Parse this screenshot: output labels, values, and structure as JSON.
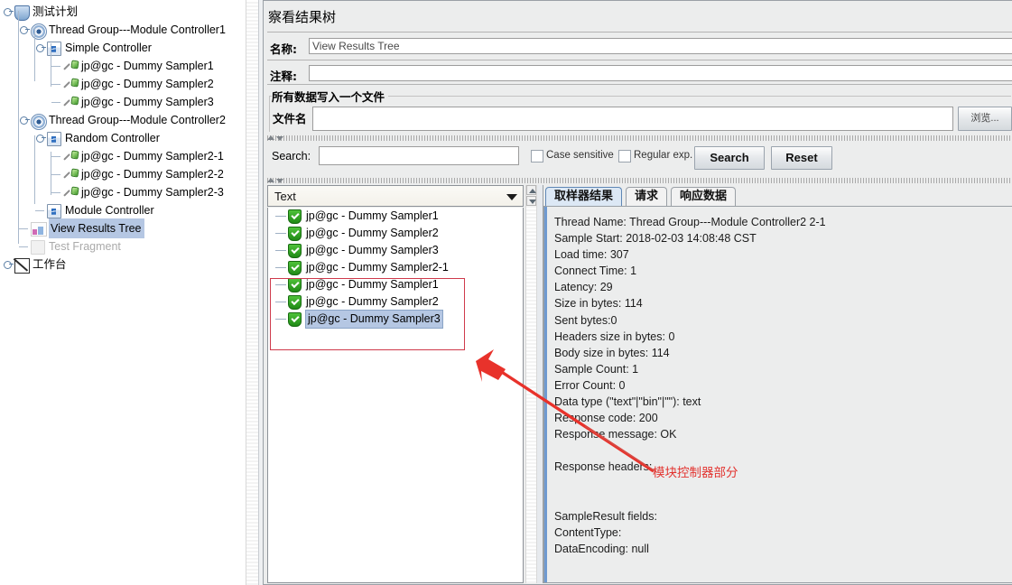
{
  "tree": {
    "nodes": [
      {
        "label": "测试计划",
        "icon": "test-plan-icon",
        "depth": 0,
        "handle": true,
        "state": "normal"
      },
      {
        "label": "Thread Group---Module Controller1",
        "icon": "thread-group-icon",
        "depth": 1,
        "handle": true,
        "state": "normal"
      },
      {
        "label": "Simple Controller",
        "icon": "controller-icon",
        "depth": 2,
        "handle": true,
        "state": "normal"
      },
      {
        "label": "jp@gc - Dummy Sampler1",
        "icon": "sampler-icon",
        "depth": 3,
        "handle": false,
        "state": "normal"
      },
      {
        "label": "jp@gc - Dummy Sampler2",
        "icon": "sampler-icon",
        "depth": 3,
        "handle": false,
        "state": "normal"
      },
      {
        "label": "jp@gc - Dummy Sampler3",
        "icon": "sampler-icon",
        "depth": 3,
        "handle": false,
        "state": "normal"
      },
      {
        "label": "Thread Group---Module Controller2",
        "icon": "thread-group-icon",
        "depth": 1,
        "handle": true,
        "state": "normal"
      },
      {
        "label": "Random Controller",
        "icon": "controller-icon",
        "depth": 2,
        "handle": true,
        "state": "normal"
      },
      {
        "label": "jp@gc - Dummy Sampler2-1",
        "icon": "sampler-icon",
        "depth": 3,
        "handle": false,
        "state": "normal"
      },
      {
        "label": "jp@gc - Dummy Sampler2-2",
        "icon": "sampler-icon",
        "depth": 3,
        "handle": false,
        "state": "normal"
      },
      {
        "label": "jp@gc - Dummy Sampler2-3",
        "icon": "sampler-icon",
        "depth": 3,
        "handle": false,
        "state": "normal"
      },
      {
        "label": "Module Controller",
        "icon": "controller-icon",
        "depth": 2,
        "handle": false,
        "state": "normal"
      },
      {
        "label": "View Results Tree",
        "icon": "view-results-tree-icon",
        "depth": 1,
        "handle": false,
        "state": "selected"
      },
      {
        "label": "Test Fragment",
        "icon": "test-fragment-icon",
        "depth": 1,
        "handle": false,
        "state": "disabled"
      },
      {
        "label": "工作台",
        "icon": "workbench-icon",
        "depth": 0,
        "handle": true,
        "state": "normal"
      }
    ]
  },
  "panel": {
    "title": "察看结果树",
    "name_label": "名称:",
    "name_value": "View Results Tree",
    "comment_label": "注释:",
    "comment_value": "",
    "groupbox_title": "所有数据写入一个文件",
    "filename_label": "文件名",
    "filename_value": "",
    "browse_label": "浏览..."
  },
  "search": {
    "label": "Search:",
    "value": "",
    "case_sensitive_label": "Case sensitive",
    "case_sensitive_checked": false,
    "regular_exp_label": "Regular exp.",
    "regular_exp_checked": false,
    "search_button": "Search",
    "reset_button": "Reset"
  },
  "results": {
    "render_selector_value": "Text",
    "rows": [
      {
        "label": "jp@gc - Dummy Sampler1",
        "status": "success",
        "selected": false
      },
      {
        "label": "jp@gc - Dummy Sampler2",
        "status": "success",
        "selected": false
      },
      {
        "label": "jp@gc - Dummy Sampler3",
        "status": "success",
        "selected": false
      },
      {
        "label": "jp@gc - Dummy Sampler2-1",
        "status": "success",
        "selected": false
      },
      {
        "label": "jp@gc - Dummy Sampler1",
        "status": "success",
        "selected": false
      },
      {
        "label": "jp@gc - Dummy Sampler2",
        "status": "success",
        "selected": false
      },
      {
        "label": "jp@gc - Dummy Sampler3",
        "status": "success",
        "selected": true
      }
    ]
  },
  "detail": {
    "tabs": [
      {
        "label": "取样器结果",
        "active": true
      },
      {
        "label": "请求",
        "active": false
      },
      {
        "label": "响应数据",
        "active": false
      }
    ],
    "body": "Thread Name: Thread Group---Module Controller2 2-1\nSample Start: 2018-02-03 14:08:48 CST\nLoad time: 307\nConnect Time: 1\nLatency: 29\nSize in bytes: 114\nSent bytes:0\nHeaders size in bytes: 0\nBody size in bytes: 114\nSample Count: 1\nError Count: 0\nData type (\"text\"|\"bin\"|\"\"): text\nResponse code: 200\nResponse message: OK\n\nResponse headers:\n\n\nSampleResult fields:\nContentType:\nDataEncoding: null"
  },
  "annotation": {
    "note_text": "模块控制器部分",
    "highlight_color": "#cf3a4b",
    "arrow_color": "#e8322b"
  }
}
